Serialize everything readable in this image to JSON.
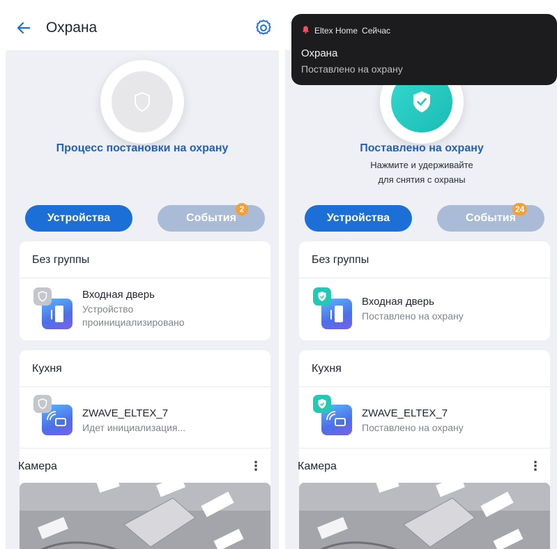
{
  "left_screen": {
    "title": "Охрана",
    "status_title": "Процесс постановки на охрану",
    "tabs": {
      "devices": "Устройства",
      "events": "События",
      "events_count": "2"
    },
    "groups": [
      {
        "name": "Без группы",
        "device_name": "Входная дверь",
        "device_status_line1": "Устройство",
        "device_status_line2": "проинициализировано"
      },
      {
        "name": "Кухня",
        "device_name": "ZWAVE_ELTEX_7",
        "device_status_line1": "Идет инициализация..."
      }
    ],
    "camera_label": "Камера"
  },
  "right_screen": {
    "status_title": "Поставлено на охрану",
    "status_sub_line1": "Нажмите и удерживайте",
    "status_sub_line2": "для снятия с охраны",
    "tabs": {
      "devices": "Устройства",
      "events": "События",
      "events_count": "24"
    },
    "groups": [
      {
        "name": "Без группы",
        "device_name": "Входная дверь",
        "device_status_line1": "Поставлено на охрану"
      },
      {
        "name": "Кухня",
        "device_name": "ZWAVE_ELTEX_7",
        "device_status_line1": "Поставлено на охрану"
      }
    ],
    "camera_label": "Камера"
  },
  "notification": {
    "app": "Eltex Home",
    "time": "Сейчас",
    "title": "Охрана",
    "body": "Поставлено на охрану"
  },
  "colors": {
    "accent": "#1d6fd8",
    "tab_inactive": "#a9bbd6",
    "badge": "#f4a035",
    "armed": "#24c9b5",
    "status_text": "#2360b9"
  }
}
